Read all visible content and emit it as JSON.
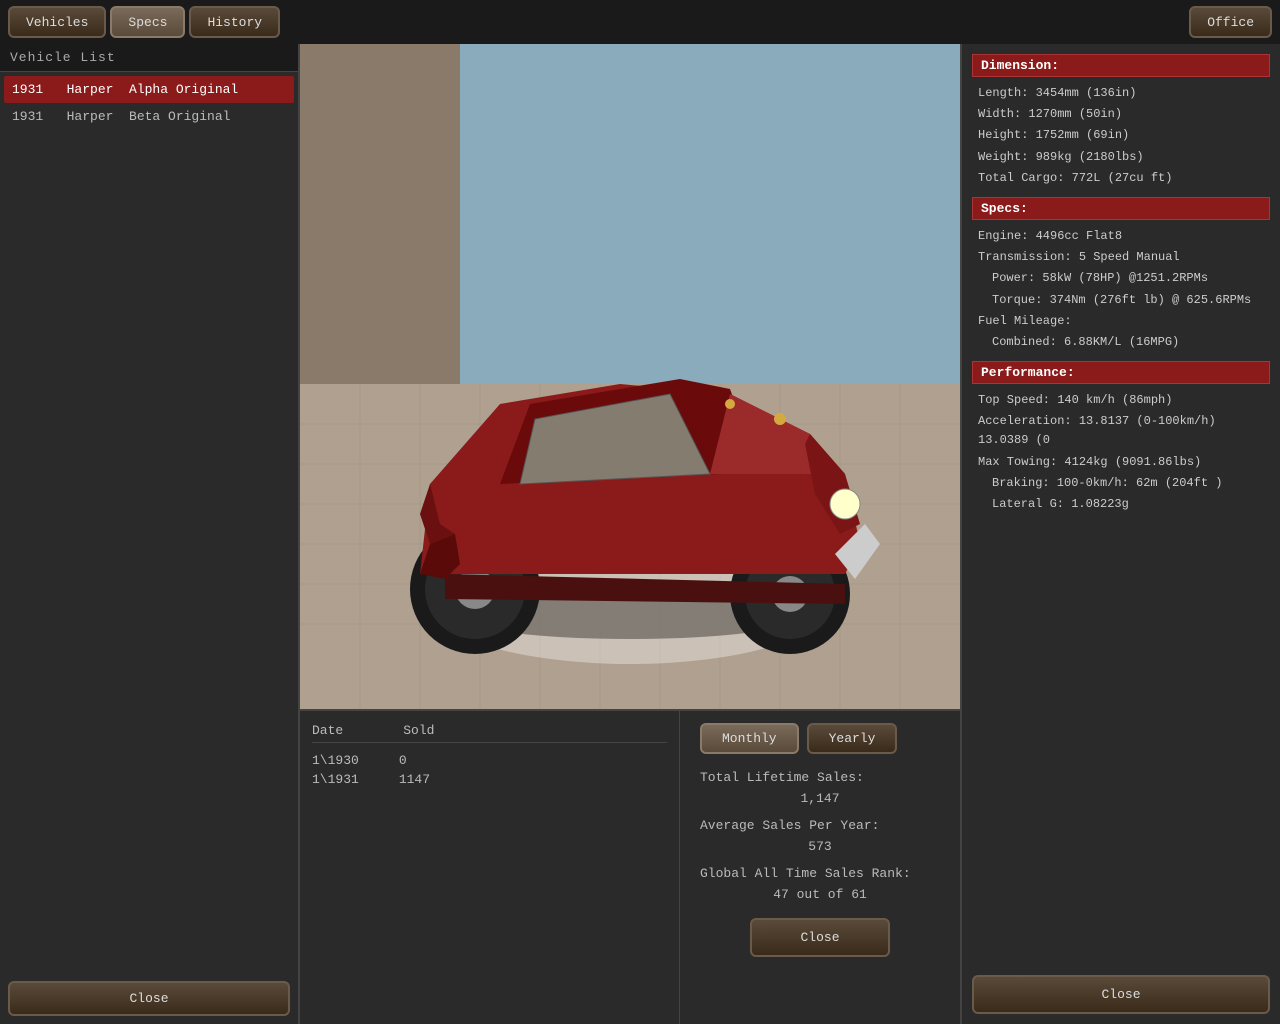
{
  "nav": {
    "vehicles_label": "Vehicles",
    "specs_label": "Specs",
    "history_label": "History",
    "office_label": "Office"
  },
  "left_panel": {
    "title": "Vehicle  List",
    "vehicles": [
      {
        "year": "1931",
        "make": "Harper",
        "model": "Alpha Original",
        "selected": true
      },
      {
        "year": "1931",
        "make": "Harper",
        "model": "Beta Original",
        "selected": false
      }
    ],
    "close_label": "Close"
  },
  "specs": {
    "dimension_title": "Dimension:",
    "length": "Length: 3454mm  (136in)",
    "width": "Width: 1270mm  (50in)",
    "height": "Height: 1752mm  (69in)",
    "weight": "Weight: 989kg  (2180lbs)",
    "cargo": "Total Cargo: 772L  (27cu ft)",
    "specs_title": "Specs:",
    "engine": "Engine: 4496cc  Flat8",
    "transmission": "Transmission: 5 Speed Manual",
    "power": "Power: 58kW (78HP)  @1251.2RPMs",
    "torque": "Torque: 374Nm (276ft lb)  @ 625.6RPMs",
    "fuel_mileage_label": "Fuel Mileage:",
    "fuel_combined": "Combined: 6.88KM/L (16MPG)",
    "performance_title": "Performance:",
    "top_speed": "Top Speed: 140 km/h (86mph)",
    "acceleration": "Acceleration: 13.8137  (0-100km/h)    13.0389 (0",
    "max_towing": "Max Towing: 4124kg (9091.86lbs)",
    "braking": "Braking: 100-0km/h: 62m      (204ft )",
    "lateral_g": "Lateral G: 1.08223g",
    "close_label": "Close"
  },
  "sales": {
    "date_header": "Date",
    "sold_header": "Sold",
    "rows": [
      {
        "date": "1\\1930",
        "sold": "0"
      },
      {
        "date": "1\\1931",
        "sold": "1147"
      }
    ],
    "monthly_label": "Monthly",
    "yearly_label": "Yearly",
    "lifetime_sales_label": "Total Lifetime Sales:",
    "lifetime_sales_value": "1,147",
    "avg_sales_label": "Average Sales Per Year:",
    "avg_sales_value": "573",
    "global_rank_label": "Global All Time Sales Rank:",
    "global_rank_value": "47 out of 61",
    "close_label": "Close"
  }
}
